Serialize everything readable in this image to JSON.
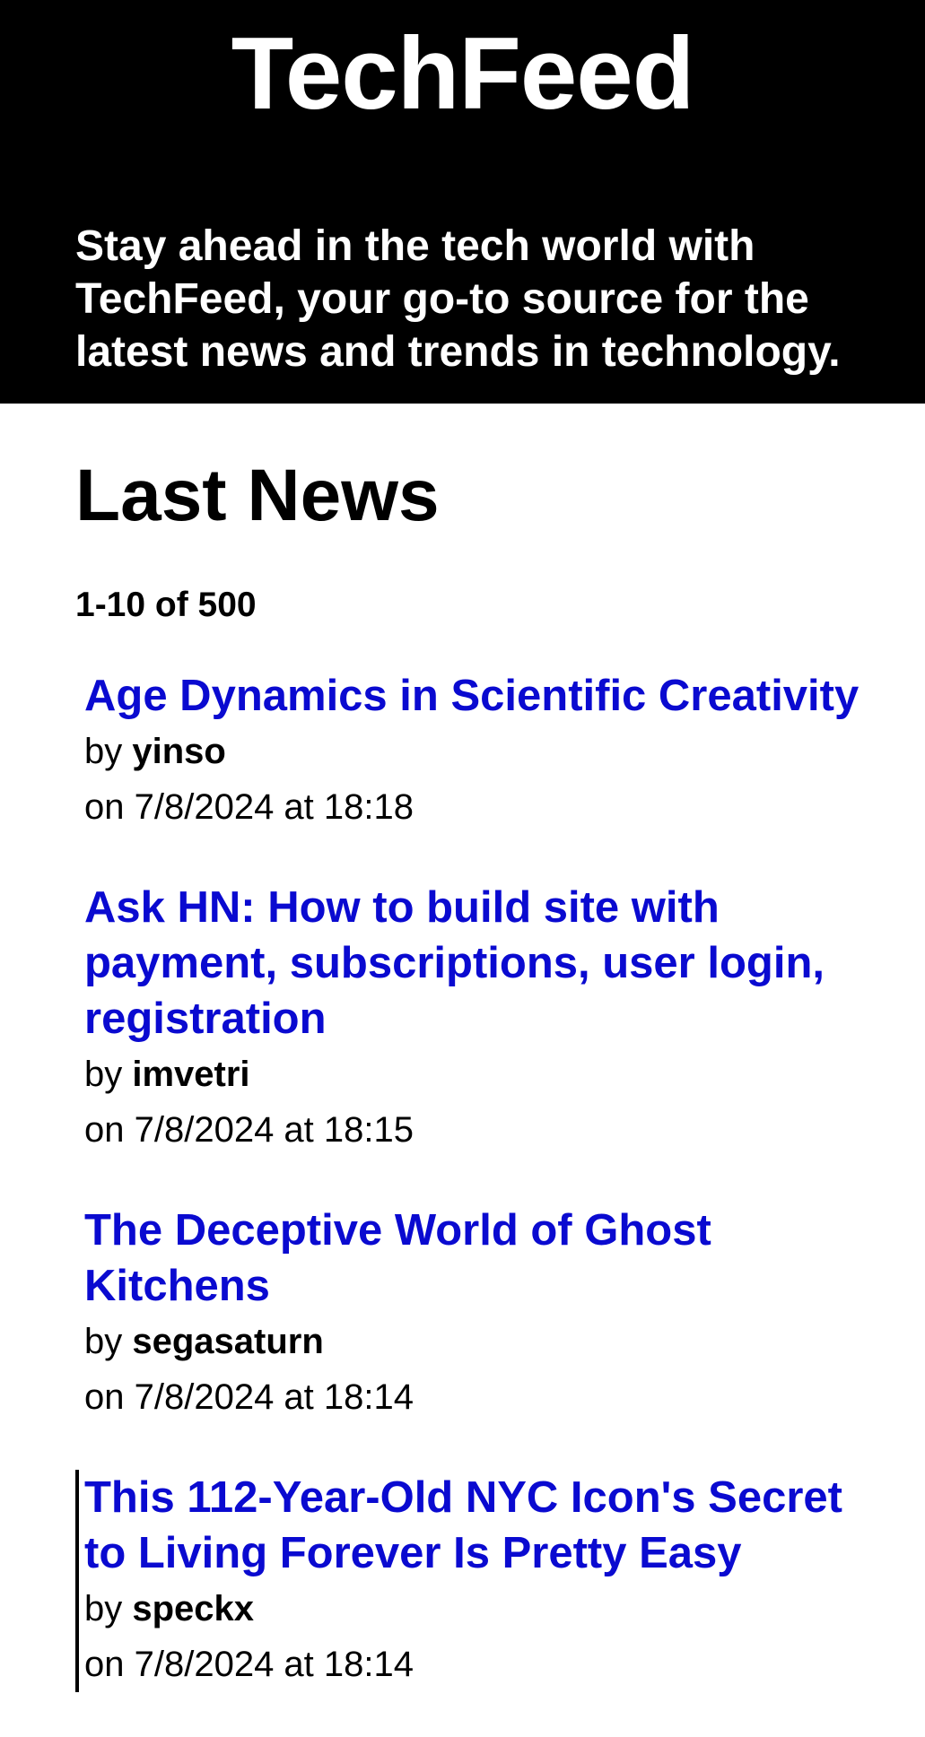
{
  "header": {
    "title": "TechFeed",
    "tagline": "Stay ahead in the tech world with TechFeed, your go-to source for the latest news and trends in technology."
  },
  "main": {
    "section_title": "Last News",
    "pagination": "1-10 of 500",
    "by_label": "by",
    "items": [
      {
        "title": "Age Dynamics in Scientific Creativity",
        "author": "yinso",
        "date": "on 7/8/2024 at 18:18"
      },
      {
        "title": "Ask HN: How to build site with payment, subscriptions, user login, registration",
        "author": "imvetri",
        "date": "on 7/8/2024 at 18:15"
      },
      {
        "title": "The Deceptive World of Ghost Kitchens",
        "author": "segasaturn",
        "date": "on 7/8/2024 at 18:14"
      },
      {
        "title": "This 112-Year-Old NYC Icon's Secret to Living Forever Is Pretty Easy",
        "author": "speckx",
        "date": "on 7/8/2024 at 18:14"
      }
    ]
  },
  "colors": {
    "header_bg": "#000000",
    "link": "#0a0ad0"
  }
}
